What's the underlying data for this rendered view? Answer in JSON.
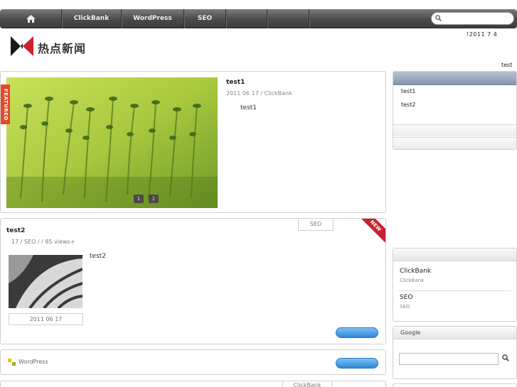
{
  "nav": {
    "items": [
      "ClickBank",
      "WordPress",
      "SEO",
      "",
      ""
    ],
    "search_placeholder": ""
  },
  "header": {
    "date": "!2011 7 4",
    "logo_text": "热点新闻",
    "top_link": "test"
  },
  "featured": {
    "ribbon": "FEATURED",
    "title": "test1",
    "meta": "2011 06 17 / ClickBank",
    "excerpt": "test1",
    "slider": [
      "1",
      "2"
    ]
  },
  "post": {
    "category_tab": "SEO",
    "new_badge": "NEW",
    "title": "test2",
    "meta": "17  / SEO /   /   85 views+",
    "excerpt": "test2",
    "date": "2011 06 17"
  },
  "catbar": {
    "label": "WordPress"
  },
  "bottom": {
    "tab": "ClickBank"
  },
  "sidebar": {
    "recent": [
      "test1",
      "test2"
    ],
    "categories": [
      {
        "name": "ClickBank",
        "sub": "ClickBank"
      },
      {
        "name": "SEO",
        "sub": "SEO"
      }
    ],
    "google_heading": "Google"
  },
  "colors": {
    "nav_bg": "#4a4a4a",
    "accent_blue": "#2f86d6",
    "ribbon_red": "#c8202e",
    "featured_orange": "#e24a2a"
  }
}
